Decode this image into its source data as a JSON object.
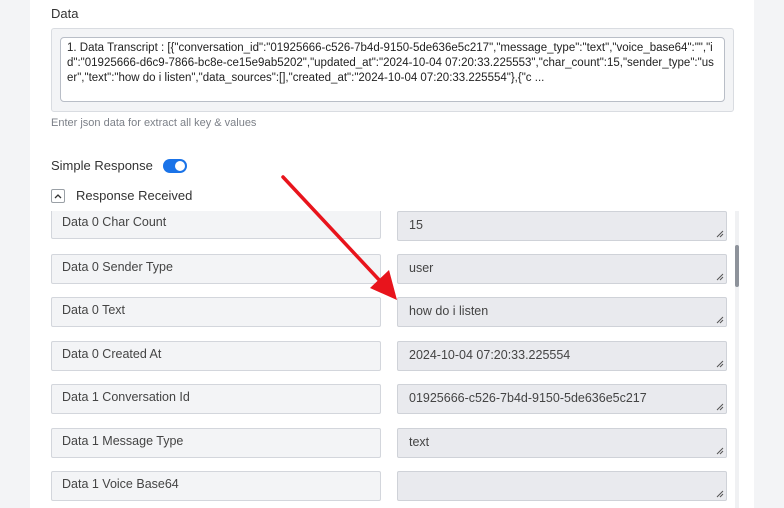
{
  "data_section": {
    "label": "Data",
    "transcript_text": "1. Data Transcript : [{\"conversation_id\":\"01925666-c526-7b4d-9150-5de636e5c217\",\"message_type\":\"text\",\"voice_base64\":\"\",\"id\":\"01925666-d6c9-7866-bc8e-ce15e9ab5202\",\"updated_at\":\"2024-10-04 07:20:33.225553\",\"char_count\":15,\"sender_type\":\"user\",\"text\":\"how do i listen\",\"data_sources\":[],\"created_at\":\"2024-10-04 07:20:33.225554\"},{\"c ...",
    "helper_text": "Enter json data for extract all key & values"
  },
  "simple_response": {
    "label": "Simple Response",
    "enabled": true,
    "accent_color": "#1a73e8"
  },
  "response_received": {
    "label": "Response Received",
    "collapse_icon": "chevron-up-icon"
  },
  "fields": [
    {
      "key": "Data 0 Char Count",
      "value": "15"
    },
    {
      "key": "Data 0 Sender Type",
      "value": "user"
    },
    {
      "key": "Data 0 Text",
      "value": "how do i listen"
    },
    {
      "key": "Data 0 Created At",
      "value": "2024-10-04 07:20:33.225554"
    },
    {
      "key": "Data 1 Conversation Id",
      "value": "01925666-c526-7b4d-9150-5de636e5c217"
    },
    {
      "key": "Data 1 Message Type",
      "value": "text"
    },
    {
      "key": "Data 1 Voice Base64",
      "value": ""
    }
  ],
  "annotation": {
    "arrow_color": "#e8141c"
  }
}
